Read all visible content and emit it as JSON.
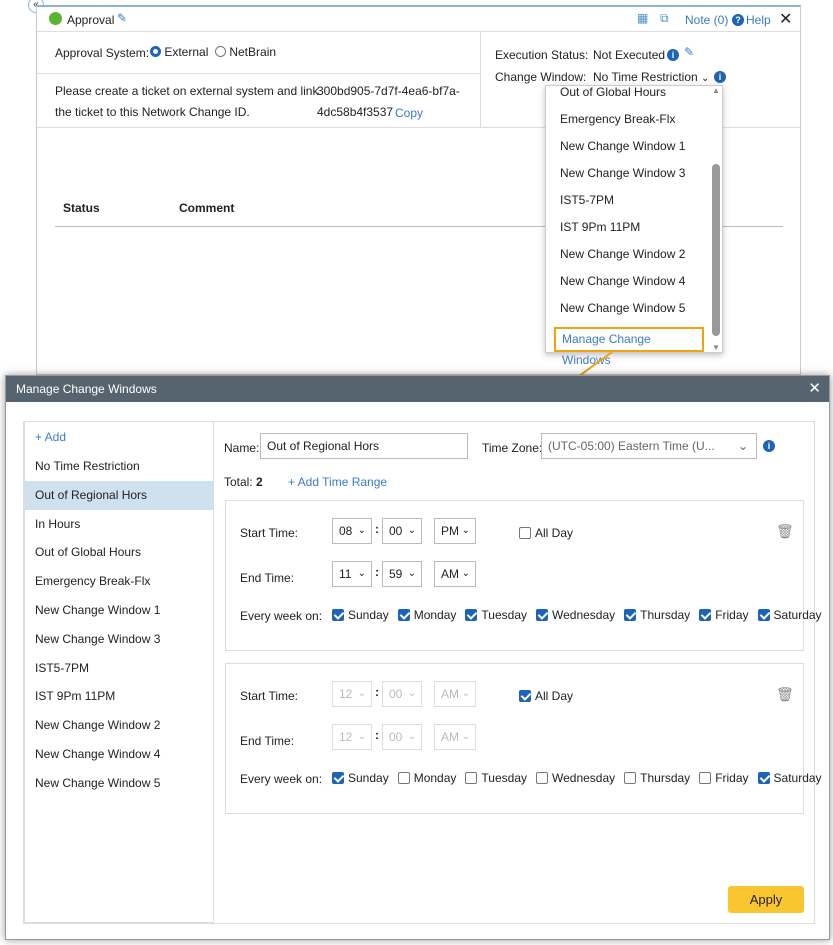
{
  "approval": {
    "title": "Approval",
    "note": "Note (0)",
    "help": "Help",
    "approval_system_label": "Approval System:",
    "opt_external": "External",
    "opt_netbrain": "NetBrain",
    "instruction_line1": "Please create a ticket on external system and link",
    "instruction_line2": "the ticket to this Network Change ID.",
    "change_id_line1": "300bd905-7d7f-4ea6-bf7a-",
    "change_id_line2": "4dc58b4f3537",
    "copy": "Copy",
    "execution_status_label": "Execution Status:",
    "execution_status": "Not Executed",
    "change_window_label": "Change Window:",
    "change_window": "No Time Restriction",
    "col_status": "Status",
    "col_comment": "Comment"
  },
  "dropdown": {
    "items": [
      "Out of Global Hours",
      "Emergency Break-Flx",
      "New Change Window 1",
      "New Change Window 3",
      "IST5-7PM",
      "IST 9Pm 11PM",
      "New Change Window 2",
      "New Change Window 4",
      "New Change Window 5"
    ],
    "manage": "Manage Change Windows"
  },
  "modal": {
    "title": "Manage Change Windows",
    "add": "+ Add",
    "windows": [
      "No Time Restriction",
      "Out of Regional Hors",
      "In Hours",
      "Out of Global Hours",
      "Emergency Break-Flx",
      "New Change Window 1",
      "New Change Window 3",
      "IST5-7PM",
      "IST 9Pm 11PM",
      "New Change Window 2",
      "New Change Window 4",
      "New Change Window 5"
    ],
    "selected_index": 1,
    "name_label": "Name:",
    "name_value": "Out of Regional Hors",
    "tz_label": "Time Zone:",
    "tz_value": "(UTC-05:00) Eastern Time (U...",
    "total_label": "Total:",
    "total": "2",
    "add_range": "+ Add Time Range",
    "start_label": "Start Time:",
    "end_label": "End Time:",
    "week_label": "Every week on:",
    "all_day": "All Day",
    "apply": "Apply",
    "days": [
      "Sunday",
      "Monday",
      "Tuesday",
      "Wednesday",
      "Thursday",
      "Friday",
      "Saturday"
    ],
    "ranges": [
      {
        "start": [
          "08",
          "00",
          "PM"
        ],
        "end": [
          "11",
          "59",
          "AM"
        ],
        "all_day": false,
        "days": [
          true,
          true,
          true,
          true,
          true,
          true,
          true
        ]
      },
      {
        "start": [
          "12",
          "00",
          "AM"
        ],
        "end": [
          "12",
          "00",
          "AM"
        ],
        "all_day": true,
        "days": [
          true,
          false,
          false,
          false,
          false,
          false,
          true
        ]
      }
    ]
  },
  "colors": {
    "accent": "#1d64b8",
    "apply": "#f9c62f",
    "header": "#56646f",
    "highlight": "#f0a30a"
  }
}
